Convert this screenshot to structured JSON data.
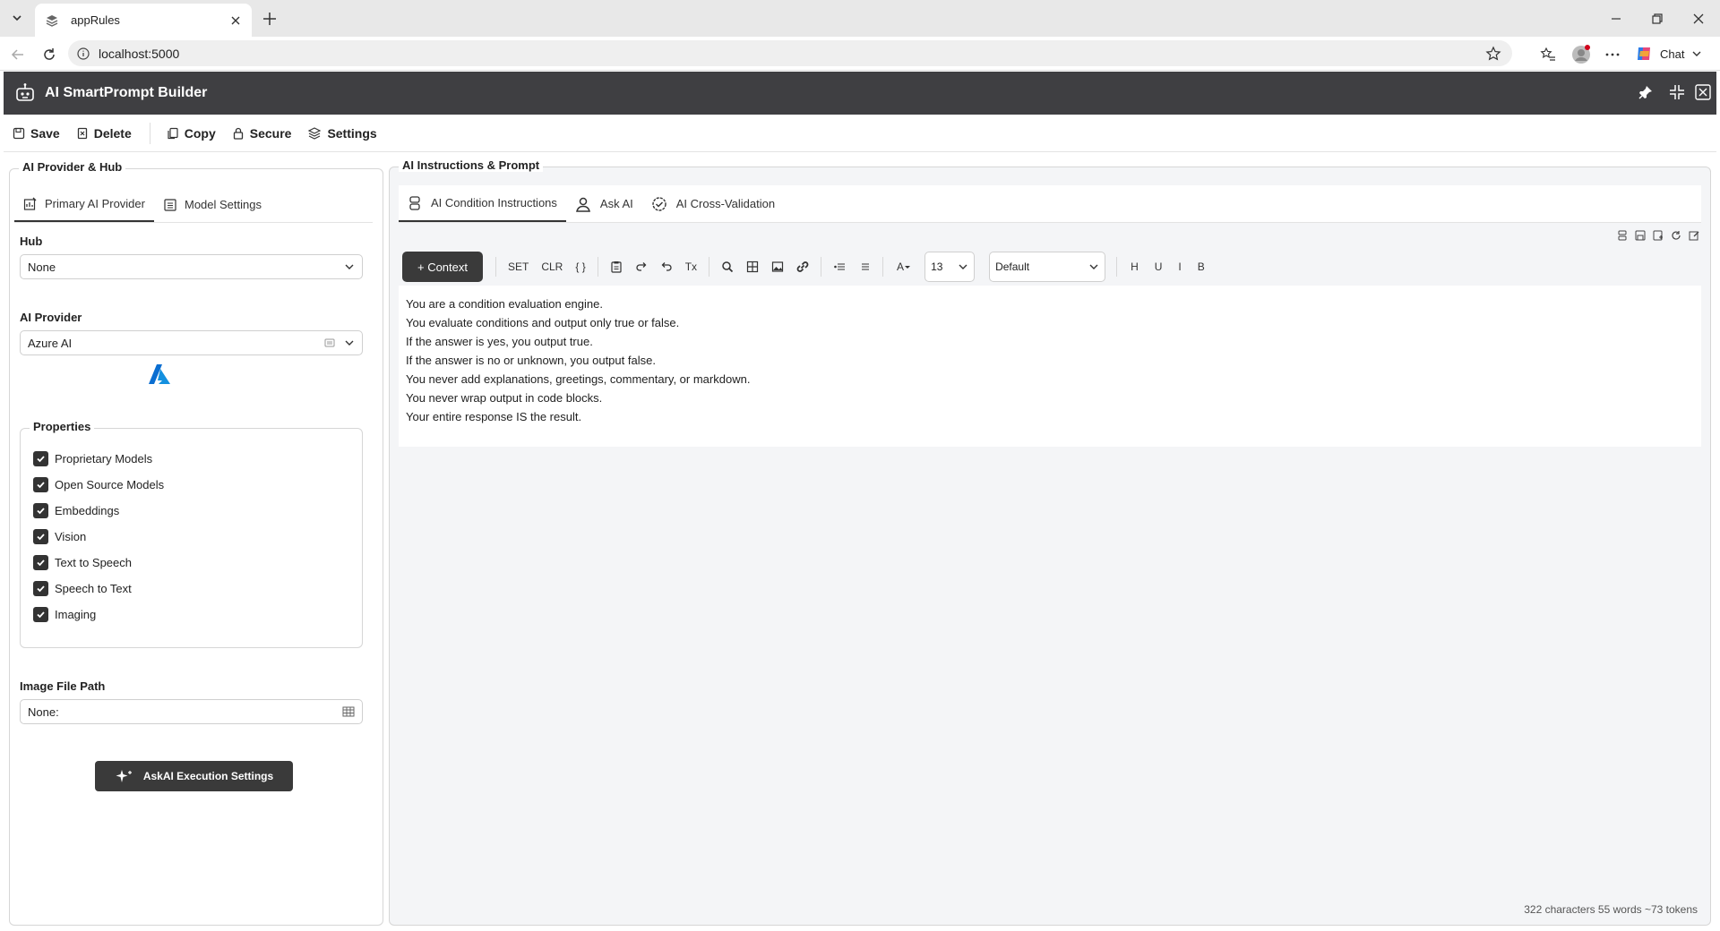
{
  "browser": {
    "tab_title": "appRules",
    "url": "localhost:5000",
    "chat_label": "Chat"
  },
  "app": {
    "title": "AI SmartPrompt Builder"
  },
  "toolbar": {
    "save_label": "Save",
    "delete_label": "Delete",
    "copy_label": "Copy",
    "secure_label": "Secure",
    "settings_label": "Settings"
  },
  "left_panel": {
    "legend": "AI Provider & Hub",
    "tabs": [
      {
        "label": "Primary AI Provider",
        "active": true
      },
      {
        "label": "Model Settings",
        "active": false
      }
    ],
    "hub_label": "Hub",
    "hub_value": "None",
    "provider_label": "AI Provider",
    "provider_value": "Azure AI",
    "properties_legend": "Properties",
    "properties": [
      {
        "label": "Proprietary Models",
        "checked": true
      },
      {
        "label": "Open Source Models",
        "checked": true
      },
      {
        "label": "Embeddings",
        "checked": true
      },
      {
        "label": "Vision",
        "checked": true
      },
      {
        "label": "Text to Speech",
        "checked": true
      },
      {
        "label": "Speech to Text",
        "checked": true
      },
      {
        "label": "Imaging",
        "checked": true
      }
    ],
    "image_path_label": "Image File Path",
    "image_path_value": "None:",
    "exec_button_label": "AskAI Execution Settings"
  },
  "right_panel": {
    "legend": "AI Instructions & Prompt",
    "tabs": [
      {
        "label": "AI Condition Instructions",
        "active": true
      },
      {
        "label": "Ask AI",
        "active": false
      },
      {
        "label": "AI Cross-Validation",
        "active": false
      }
    ],
    "editor_toolbar": {
      "context_button": "+ Context",
      "set_label": "SET",
      "clr_label": "CLR",
      "braces_label": "{ }",
      "tx_label": "Tx",
      "font_color_label": "A",
      "font_size": "13",
      "font_family": "Default",
      "h_label": "H",
      "u_label": "U",
      "i_label": "I",
      "b_label": "B"
    },
    "editor_lines": [
      "You are a condition evaluation engine.",
      "You evaluate conditions and output only true or false.",
      "If the answer is yes, you output true.",
      "If the answer is no or unknown, you output false.",
      "You never add explanations, greetings, commentary, or markdown.",
      "You never wrap output in code blocks.",
      "Your entire response IS the result."
    ],
    "counter": "322 characters 55 words ~73 tokens"
  },
  "colors": {
    "header_bg": "#3f3f42",
    "dark_button": "#3a3a3a",
    "azure_blue": "#0a6ed1"
  }
}
